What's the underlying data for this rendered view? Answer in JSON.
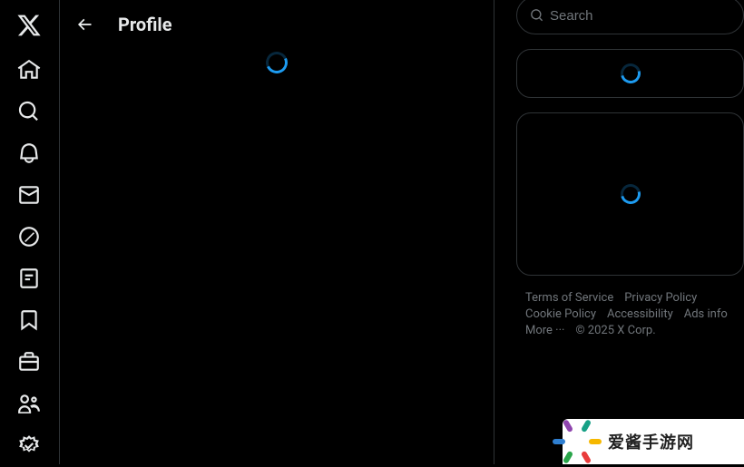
{
  "header": {
    "title": "Profile"
  },
  "search": {
    "placeholder": "Search"
  },
  "footer": {
    "links": [
      "Terms of Service",
      "Privacy Policy",
      "Cookie Policy",
      "Accessibility",
      "Ads info",
      "More ···"
    ],
    "copyright": "© 2025 X Corp."
  },
  "brand": {
    "text": "爱酱手游网"
  }
}
